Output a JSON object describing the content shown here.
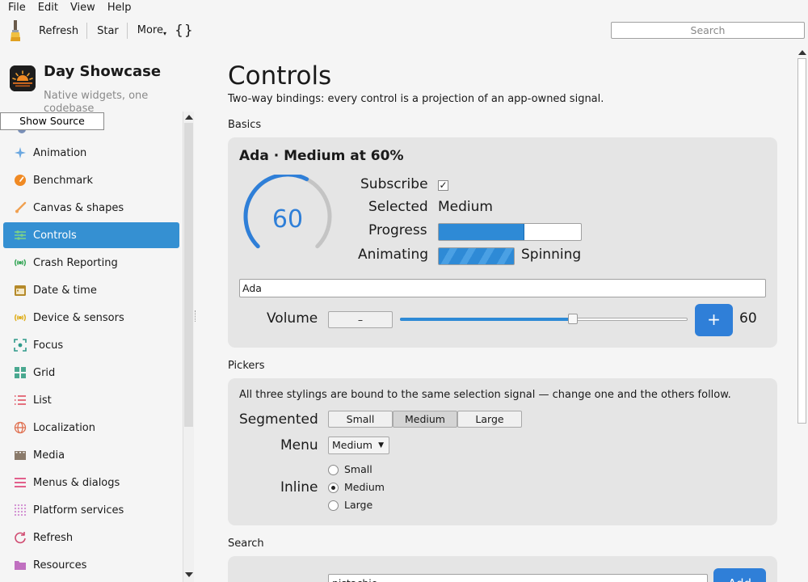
{
  "menubar": {
    "items": [
      "File",
      "Edit",
      "View",
      "Help"
    ]
  },
  "toolbar": {
    "refresh": "Refresh",
    "star": "Star",
    "more": "More",
    "braces": "{}",
    "search_placeholder": "Search"
  },
  "sidebar": {
    "title": "Day Showcase",
    "subtitle": "Native widgets, one codebase",
    "show_source": "Show Source",
    "items": [
      {
        "label": "Animation",
        "icon": "sparkle-icon",
        "color": "#6aa7e0"
      },
      {
        "label": "Benchmark",
        "icon": "speedometer-icon",
        "color": "#f08a24"
      },
      {
        "label": "Canvas & shapes",
        "icon": "brush-icon",
        "color": "#f0a050"
      },
      {
        "label": "Controls",
        "icon": "sliders-icon",
        "color": "#3aa85a"
      },
      {
        "label": "Crash Reporting",
        "icon": "radio-waves-icon",
        "color": "#3aa85a"
      },
      {
        "label": "Date & time",
        "icon": "calendar-icon",
        "color": "#b58a2a"
      },
      {
        "label": "Device & sensors",
        "icon": "sensor-waves-icon",
        "color": "#e0b020"
      },
      {
        "label": "Focus",
        "icon": "focus-icon",
        "color": "#2e9a8a"
      },
      {
        "label": "Grid",
        "icon": "grid-icon",
        "color": "#4aa890"
      },
      {
        "label": "List",
        "icon": "list-icon",
        "color": "#e05060"
      },
      {
        "label": "Localization",
        "icon": "globe-icon",
        "color": "#e07050"
      },
      {
        "label": "Media",
        "icon": "film-icon",
        "color": "#8a7a6a"
      },
      {
        "label": "Menus & dialogs",
        "icon": "menu-lines-icon",
        "color": "#e05080"
      },
      {
        "label": "Platform services",
        "icon": "dots-grid-icon",
        "color": "#d08ad0"
      },
      {
        "label": "Refresh",
        "icon": "refresh-icon",
        "color": "#d04a70"
      },
      {
        "label": "Resources",
        "icon": "folder-icon",
        "color": "#c070c0"
      }
    ]
  },
  "main": {
    "title": "Controls",
    "subtitle": "Two-way bindings: every control is a projection of an app-owned signal.",
    "basics": {
      "section": "Basics",
      "card_title": "Ada · Medium at 60%",
      "gauge_value": "60",
      "gauge_fraction": 0.6,
      "subscribe_label": "Subscribe",
      "subscribed": true,
      "selected_label": "Selected",
      "selected_value": "Medium",
      "progress_label": "Progress",
      "progress": 0.6,
      "animating_label": "Animating",
      "animating_status": "Spinning",
      "name_value": "Ada",
      "volume_label": "Volume",
      "minus": "–",
      "plus": "+",
      "volume_value": "60",
      "volume_fraction": 0.6
    },
    "pickers": {
      "section": "Pickers",
      "note": "All three stylings are bound to the same selection signal — change one and the others follow.",
      "segmented_label": "Segmented",
      "segments": [
        "Small",
        "Medium",
        "Large"
      ],
      "selected_index": 1,
      "menu_label": "Menu",
      "menu_value": "Medium",
      "inline_label": "Inline",
      "inline_options": [
        "Small",
        "Medium",
        "Large"
      ]
    },
    "search": {
      "section": "Search",
      "field_value": "pistachio",
      "add": "Add"
    }
  },
  "colors": {
    "accent": "#3590d2",
    "plus_button": "#2f7fd8",
    "card": "#e5e5e5"
  }
}
